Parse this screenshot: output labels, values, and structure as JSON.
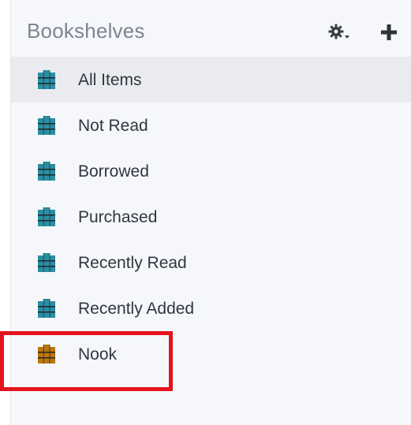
{
  "header": {
    "title": "Bookshelves",
    "settings_icon": "gear-dropdown-icon",
    "add_icon": "plus-icon"
  },
  "shelves": [
    {
      "label": "All Items",
      "icon": "bookshelf-icon",
      "color": "#2a8fa4",
      "selected": true
    },
    {
      "label": "Not Read",
      "icon": "bookshelf-icon",
      "color": "#2a8fa4"
    },
    {
      "label": "Borrowed",
      "icon": "bookshelf-icon",
      "color": "#2a8fa4"
    },
    {
      "label": "Purchased",
      "icon": "bookshelf-icon",
      "color": "#2a8fa4"
    },
    {
      "label": "Recently Read",
      "icon": "bookshelf-icon",
      "color": "#2a8fa4"
    },
    {
      "label": "Recently Added",
      "icon": "bookshelf-icon",
      "color": "#2a8fa4"
    },
    {
      "label": "Nook",
      "icon": "bookshelf-icon",
      "color": "#b8780f"
    }
  ],
  "colors": {
    "highlight_box": "#e3141d"
  }
}
